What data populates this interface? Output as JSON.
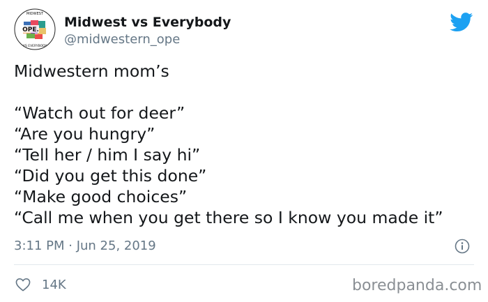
{
  "author": {
    "display_name": "Midwest vs Everybody",
    "handle": "@midwestern_ope",
    "avatar_text": "OPE.",
    "avatar_ring_top": "MIDWEST",
    "avatar_ring_bottom": "VS EVERYBODY"
  },
  "tweet": {
    "lines": [
      "Midwestern mom’s",
      "",
      "“Watch out for deer”",
      "“Are you hungry”",
      "“Tell her / him  I say hi”",
      "“Did you get this done”",
      "“Make good choices”",
      "“Call me when you get there so I know you made it”"
    ],
    "timestamp": "3:11 PM · Jun 25, 2019"
  },
  "actions": {
    "like_count": "14K"
  },
  "watermark": "boredpanda.com",
  "icons": {
    "brand": "twitter-bird-icon",
    "info": "info-icon",
    "like": "heart-icon"
  },
  "colors": {
    "twitter_blue": "#1da1f2",
    "text": "#14171a",
    "secondary": "#657786",
    "divider": "#e1e8ed"
  }
}
